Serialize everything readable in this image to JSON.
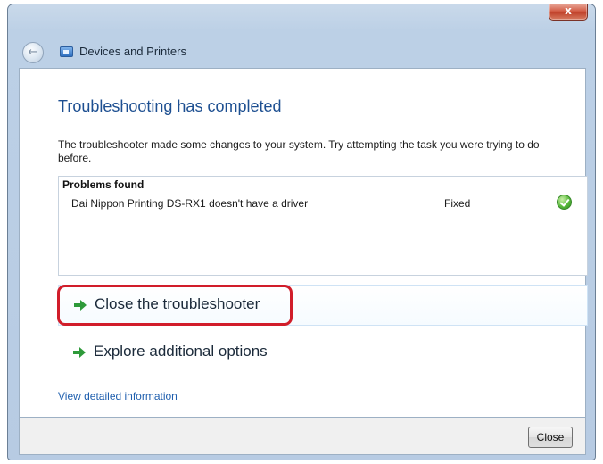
{
  "window": {
    "close_glyph": "x",
    "title": "Devices and Printers"
  },
  "content": {
    "heading": "Troubleshooting has completed",
    "description": "The troubleshooter made some changes to your system. Try attempting the task you were trying to do before.",
    "problems": {
      "header": "Problems found",
      "rows": [
        {
          "description": "Dai Nippon Printing DS-RX1 doesn't have a driver",
          "status": "Fixed",
          "status_icon": "check-icon"
        }
      ]
    },
    "options": [
      {
        "label": "Close the troubleshooter",
        "icon": "green-arrow-icon",
        "highlighted": true
      },
      {
        "label": "Explore additional options",
        "icon": "green-arrow-icon"
      }
    ],
    "details_link": "View detailed information"
  },
  "footer": {
    "close_button": "Close"
  },
  "colors": {
    "heading": "#1d4f91",
    "link": "#1f5fae",
    "highlight_ring": "#d11d2a",
    "check_green": "#58b93b",
    "arrow_green": "#2e9a3a"
  }
}
